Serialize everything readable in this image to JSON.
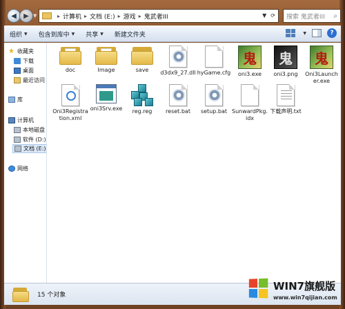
{
  "address": {
    "crumbs": [
      "计算机",
      "文档 (E:)",
      "游戏",
      "鬼武者III"
    ]
  },
  "search": {
    "placeholder": "搜索 鬼武者III"
  },
  "toolbar": {
    "organize": "组织",
    "include_in_library": "包含到库中",
    "share": "共享",
    "new_folder": "新建文件夹"
  },
  "nav": {
    "favorites": "收藏夹",
    "downloads": "下载",
    "desktop": "桌面",
    "recent": "最近访问",
    "libraries": "库",
    "computer": "计算机",
    "local_disk": "本地磁盘",
    "drive_d": "软件 (D:)",
    "drive_e": "文档 (E:)",
    "network": "网络"
  },
  "files": [
    {
      "label": "doc",
      "icon": "folder-icon"
    },
    {
      "label": "Image",
      "icon": "folder-icon"
    },
    {
      "label": "save",
      "icon": "folder-icon"
    },
    {
      "label": "d3dx9_27.dll",
      "icon": "dll-file-icon"
    },
    {
      "label": "hyGame.cfg",
      "icon": "blank-file-icon"
    },
    {
      "label": "oni3.exe",
      "icon": "game-exe-icon"
    },
    {
      "label": "oni3.png",
      "icon": "png-image-icon"
    },
    {
      "label": "Oni3Launcher.exe",
      "icon": "game-exe-icon"
    },
    {
      "label": "Oni3Registration.xml",
      "icon": "xml-file-icon"
    },
    {
      "label": "oni3Srv.exe",
      "icon": "app-exe-icon"
    },
    {
      "label": "reg.reg",
      "icon": "registry-file-icon"
    },
    {
      "label": "reset.bat",
      "icon": "batch-file-icon"
    },
    {
      "label": "setup.bat",
      "icon": "batch-file-icon"
    },
    {
      "label": "SunwardPkg.idx",
      "icon": "blank-file-icon"
    },
    {
      "label": "下载声明.txt",
      "icon": "text-file-icon"
    }
  ],
  "status": {
    "count": "15 个对象"
  },
  "watermark": {
    "title": "WIN7旗舰版",
    "url": "www.win7qijian.com"
  }
}
